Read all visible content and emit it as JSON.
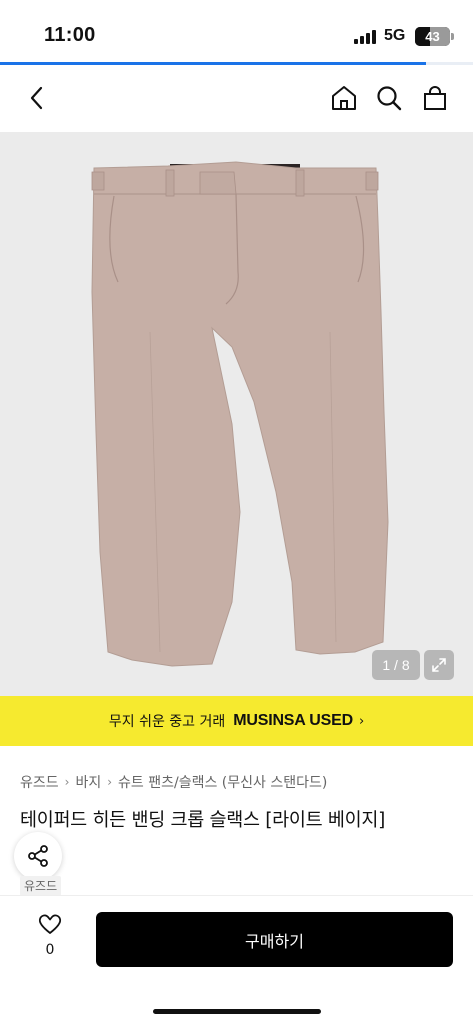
{
  "status_bar": {
    "time": "11:00",
    "network": "5G",
    "battery": "43",
    "battery_level": 0.43
  },
  "page_load_progress": 0.9,
  "nav": {
    "back_icon": "chevron-left-icon",
    "home_icon": "home-icon",
    "search_icon": "search-icon",
    "cart_icon": "shopping-bag-icon"
  },
  "gallery": {
    "counter": "1 / 8",
    "expand_icon": "expand-icon"
  },
  "banner": {
    "text": "무지 쉬운 중고 거래",
    "brand": "MUSINSA USED",
    "arrow": "›",
    "background": "#f6ea2f"
  },
  "breadcrumb": [
    "유즈드",
    "바지",
    "슈트 팬츠/슬랙스 (무신사 스탠다드)"
  ],
  "product": {
    "title": "테이퍼드 히든 밴딩 크롭 슬랙스 [라이트 베이지]",
    "brand_tag": "유즈드",
    "color": "#c6afa6"
  },
  "share_icon": "share-icon",
  "bottom_bar": {
    "like_count": "0",
    "buy_label": "구매하기"
  }
}
